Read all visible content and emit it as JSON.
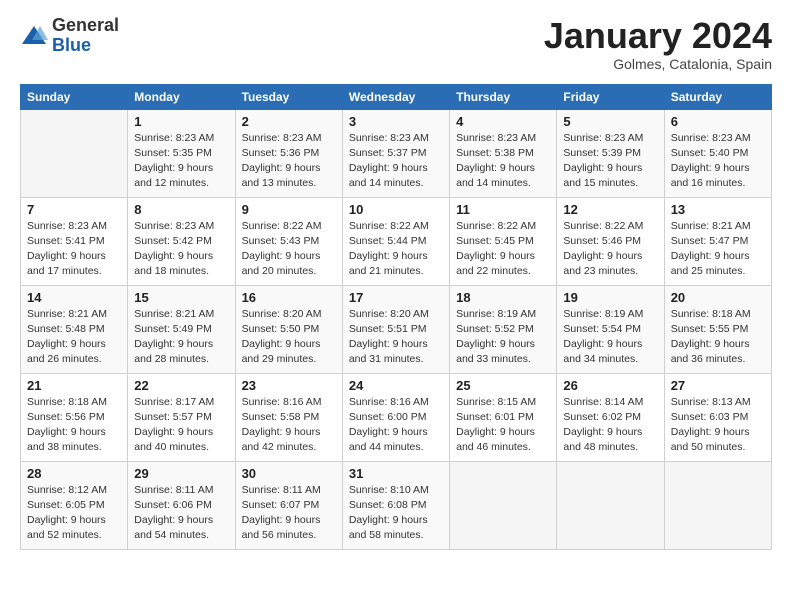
{
  "logo": {
    "general": "General",
    "blue": "Blue"
  },
  "title": "January 2024",
  "location": "Golmes, Catalonia, Spain",
  "weekdays": [
    "Sunday",
    "Monday",
    "Tuesday",
    "Wednesday",
    "Thursday",
    "Friday",
    "Saturday"
  ],
  "weeks": [
    [
      {
        "day": "",
        "info": ""
      },
      {
        "day": "1",
        "info": "Sunrise: 8:23 AM\nSunset: 5:35 PM\nDaylight: 9 hours\nand 12 minutes."
      },
      {
        "day": "2",
        "info": "Sunrise: 8:23 AM\nSunset: 5:36 PM\nDaylight: 9 hours\nand 13 minutes."
      },
      {
        "day": "3",
        "info": "Sunrise: 8:23 AM\nSunset: 5:37 PM\nDaylight: 9 hours\nand 14 minutes."
      },
      {
        "day": "4",
        "info": "Sunrise: 8:23 AM\nSunset: 5:38 PM\nDaylight: 9 hours\nand 14 minutes."
      },
      {
        "day": "5",
        "info": "Sunrise: 8:23 AM\nSunset: 5:39 PM\nDaylight: 9 hours\nand 15 minutes."
      },
      {
        "day": "6",
        "info": "Sunrise: 8:23 AM\nSunset: 5:40 PM\nDaylight: 9 hours\nand 16 minutes."
      }
    ],
    [
      {
        "day": "7",
        "info": "Sunrise: 8:23 AM\nSunset: 5:41 PM\nDaylight: 9 hours\nand 17 minutes."
      },
      {
        "day": "8",
        "info": "Sunrise: 8:23 AM\nSunset: 5:42 PM\nDaylight: 9 hours\nand 18 minutes."
      },
      {
        "day": "9",
        "info": "Sunrise: 8:22 AM\nSunset: 5:43 PM\nDaylight: 9 hours\nand 20 minutes."
      },
      {
        "day": "10",
        "info": "Sunrise: 8:22 AM\nSunset: 5:44 PM\nDaylight: 9 hours\nand 21 minutes."
      },
      {
        "day": "11",
        "info": "Sunrise: 8:22 AM\nSunset: 5:45 PM\nDaylight: 9 hours\nand 22 minutes."
      },
      {
        "day": "12",
        "info": "Sunrise: 8:22 AM\nSunset: 5:46 PM\nDaylight: 9 hours\nand 23 minutes."
      },
      {
        "day": "13",
        "info": "Sunrise: 8:21 AM\nSunset: 5:47 PM\nDaylight: 9 hours\nand 25 minutes."
      }
    ],
    [
      {
        "day": "14",
        "info": "Sunrise: 8:21 AM\nSunset: 5:48 PM\nDaylight: 9 hours\nand 26 minutes."
      },
      {
        "day": "15",
        "info": "Sunrise: 8:21 AM\nSunset: 5:49 PM\nDaylight: 9 hours\nand 28 minutes."
      },
      {
        "day": "16",
        "info": "Sunrise: 8:20 AM\nSunset: 5:50 PM\nDaylight: 9 hours\nand 29 minutes."
      },
      {
        "day": "17",
        "info": "Sunrise: 8:20 AM\nSunset: 5:51 PM\nDaylight: 9 hours\nand 31 minutes."
      },
      {
        "day": "18",
        "info": "Sunrise: 8:19 AM\nSunset: 5:52 PM\nDaylight: 9 hours\nand 33 minutes."
      },
      {
        "day": "19",
        "info": "Sunrise: 8:19 AM\nSunset: 5:54 PM\nDaylight: 9 hours\nand 34 minutes."
      },
      {
        "day": "20",
        "info": "Sunrise: 8:18 AM\nSunset: 5:55 PM\nDaylight: 9 hours\nand 36 minutes."
      }
    ],
    [
      {
        "day": "21",
        "info": "Sunrise: 8:18 AM\nSunset: 5:56 PM\nDaylight: 9 hours\nand 38 minutes."
      },
      {
        "day": "22",
        "info": "Sunrise: 8:17 AM\nSunset: 5:57 PM\nDaylight: 9 hours\nand 40 minutes."
      },
      {
        "day": "23",
        "info": "Sunrise: 8:16 AM\nSunset: 5:58 PM\nDaylight: 9 hours\nand 42 minutes."
      },
      {
        "day": "24",
        "info": "Sunrise: 8:16 AM\nSunset: 6:00 PM\nDaylight: 9 hours\nand 44 minutes."
      },
      {
        "day": "25",
        "info": "Sunrise: 8:15 AM\nSunset: 6:01 PM\nDaylight: 9 hours\nand 46 minutes."
      },
      {
        "day": "26",
        "info": "Sunrise: 8:14 AM\nSunset: 6:02 PM\nDaylight: 9 hours\nand 48 minutes."
      },
      {
        "day": "27",
        "info": "Sunrise: 8:13 AM\nSunset: 6:03 PM\nDaylight: 9 hours\nand 50 minutes."
      }
    ],
    [
      {
        "day": "28",
        "info": "Sunrise: 8:12 AM\nSunset: 6:05 PM\nDaylight: 9 hours\nand 52 minutes."
      },
      {
        "day": "29",
        "info": "Sunrise: 8:11 AM\nSunset: 6:06 PM\nDaylight: 9 hours\nand 54 minutes."
      },
      {
        "day": "30",
        "info": "Sunrise: 8:11 AM\nSunset: 6:07 PM\nDaylight: 9 hours\nand 56 minutes."
      },
      {
        "day": "31",
        "info": "Sunrise: 8:10 AM\nSunset: 6:08 PM\nDaylight: 9 hours\nand 58 minutes."
      },
      {
        "day": "",
        "info": ""
      },
      {
        "day": "",
        "info": ""
      },
      {
        "day": "",
        "info": ""
      }
    ]
  ]
}
